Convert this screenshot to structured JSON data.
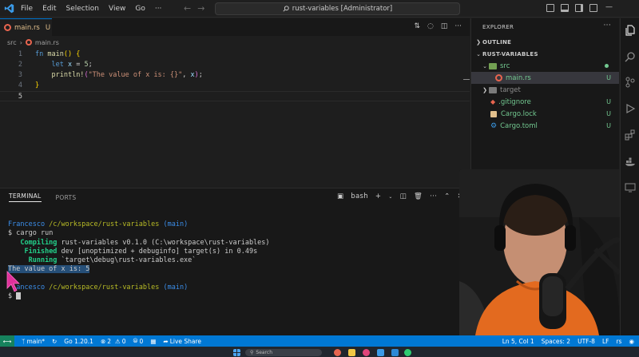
{
  "titlebar": {
    "menu": [
      "File",
      "Edit",
      "Selection",
      "View",
      "Go",
      "···"
    ],
    "command_center": "rust-variables [Administrator]"
  },
  "editor": {
    "tab": {
      "filename": "main.rs",
      "status": "U"
    },
    "breadcrumb": {
      "folder": "src",
      "file": "main.rs"
    },
    "lines": [
      {
        "num": "1"
      },
      {
        "num": "2"
      },
      {
        "num": "3"
      },
      {
        "num": "4"
      },
      {
        "num": "5"
      }
    ],
    "code": {
      "l1_kw": "fn",
      "l1_fn": "main",
      "l1_paren": "()",
      "l1_brace": "{",
      "l2_kw": "let",
      "l2_var": "x",
      "l2_eq": " = ",
      "l2_num": "5",
      "l2_semi": ";",
      "l3_mac": "println!",
      "l3_open": "(",
      "l3_str": "\"The value of x is: {}\"",
      "l3_comma": ", ",
      "l3_var": "x",
      "l3_close": ")",
      "l3_semi": ";",
      "l4_brace": "}"
    }
  },
  "panel": {
    "tabs": [
      "TERMINAL",
      "PORTS"
    ],
    "shell": "bash",
    "terminal": {
      "prompt_user": "Francesco",
      "prompt_path": "/c/workspace/rust-variables",
      "prompt_branch": "(main)",
      "cmd_prefix": "$ ",
      "cmd": "cargo run",
      "compiling_label": "Compiling",
      "compiling_text": " rust-variables v0.1.0 (C:\\workspace\\rust-variables)",
      "finished_label": "Finished",
      "finished_text": " dev [unoptimized + debuginfo] target(s) in 0.49s",
      "running_label": "Running",
      "running_text": " `target\\debug\\rust-variables.exe`",
      "output": "The value of x is: 5",
      "prompt2_user": "ancesco",
      "prompt2_path": "/c/workspace/rust-variables",
      "prompt2_branch": "(main)",
      "prompt2_cmd": "$ "
    }
  },
  "explorer": {
    "title": "EXPLORER",
    "outline": "OUTLINE",
    "project": "RUST-VARIABLES",
    "items": [
      {
        "name": "src",
        "status": ""
      },
      {
        "name": "main.rs",
        "status": "U"
      },
      {
        "name": "target",
        "status": ""
      },
      {
        "name": ".gitignore",
        "status": "U"
      },
      {
        "name": "Cargo.lock",
        "status": "U"
      },
      {
        "name": "Cargo.toml",
        "status": "U"
      }
    ]
  },
  "statusbar": {
    "branch": "main*",
    "go_version": "Go 1.20.1",
    "errors": "2",
    "warnings": "0",
    "ports": "0",
    "live_share": "Live Share",
    "position": "Ln 5, Col 1",
    "spaces": "Spaces: 2",
    "encoding": "UTF-8",
    "eol": "LF",
    "language": "rs"
  },
  "taskbar": {
    "search_placeholder": "Search"
  },
  "colors": {
    "accent": "#0078d4",
    "remote": "#16825d",
    "git_untracked": "#73c991",
    "rust_icon": "#e8654f"
  }
}
